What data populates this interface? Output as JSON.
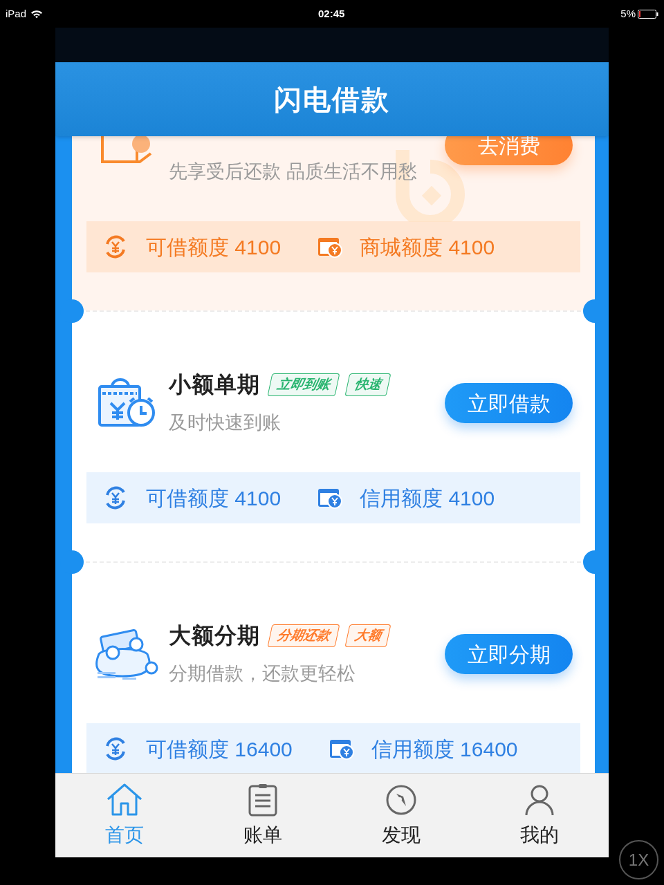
{
  "status_bar": {
    "device": "iPad",
    "time": "02:45",
    "battery": "5%"
  },
  "header": {
    "title": "闪电借款"
  },
  "cards": [
    {
      "kind": "orange",
      "subtitle": "先享受后还款 品质生活不用愁",
      "button": "去消费",
      "quotas": [
        {
          "label": "可借额度 4100"
        },
        {
          "label": "商城额度 4100"
        }
      ]
    },
    {
      "kind": "blue",
      "title": "小额单期",
      "tags": [
        {
          "text": "立即到账",
          "color": "#27b46e"
        },
        {
          "text": "快速",
          "color": "#27b46e"
        }
      ],
      "subtitle": "及时快速到账",
      "button": "立即借款",
      "quotas": [
        {
          "label": "可借额度 4100"
        },
        {
          "label": "信用额度 4100"
        }
      ]
    },
    {
      "kind": "blue",
      "title": "大额分期",
      "tags": [
        {
          "text": "分期还款",
          "color": "#ff7a2a"
        },
        {
          "text": "大额",
          "color": "#ff7a2a"
        }
      ],
      "subtitle": "分期借款，还款更轻松",
      "button": "立即分期",
      "quotas": [
        {
          "label": "可借额度 16400"
        },
        {
          "label": "信用额度 16400"
        }
      ]
    }
  ],
  "nav": [
    {
      "label": "首页",
      "selected": true
    },
    {
      "label": "账单",
      "selected": false
    },
    {
      "label": "发现",
      "selected": false
    },
    {
      "label": "我的",
      "selected": false
    }
  ],
  "zoom_button": "1X"
}
